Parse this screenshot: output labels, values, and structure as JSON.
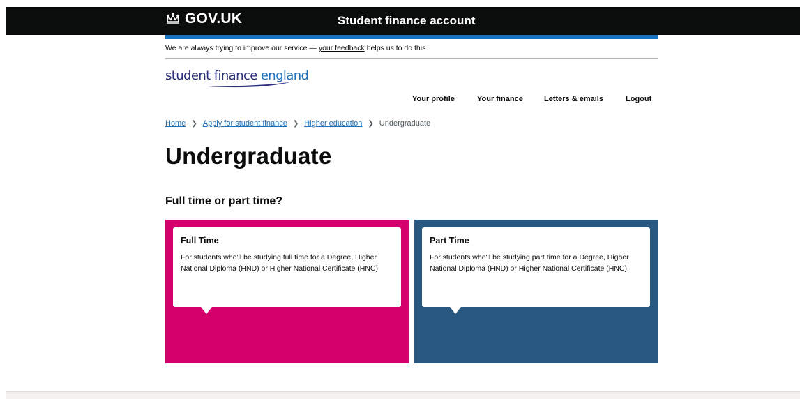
{
  "header": {
    "logo_text": "GOV.UK",
    "service_name": "Student finance account"
  },
  "feedback": {
    "prefix": "We are always trying to improve our service — ",
    "link": "your feedback",
    "suffix": " helps us to do this"
  },
  "brand": {
    "part1": "student finance ",
    "part2": "england"
  },
  "nav": {
    "profile": "Your profile",
    "finance": "Your finance",
    "letters": "Letters & emails",
    "logout": "Logout"
  },
  "breadcrumbs": {
    "home": "Home",
    "apply": "Apply for student finance",
    "higher": "Higher education",
    "current": "Undergraduate"
  },
  "page_title": "Undergraduate",
  "question": "Full time or part time?",
  "options": [
    {
      "title": "Full Time",
      "description": "For students who'll be studying full time for a Degree, Higher National Diploma (HND) or Higher National Certificate (HNC).",
      "color": "#d6006d"
    },
    {
      "title": "Part Time",
      "description": "For students who'll be studying part time for a Degree, Higher National Diploma (HND) or Higher National Certificate (HNC).",
      "color": "#28577f"
    }
  ],
  "colors": {
    "header_bg": "#0b0c0c",
    "accent_blue": "#1d70b8",
    "link": "#1d70b8"
  }
}
